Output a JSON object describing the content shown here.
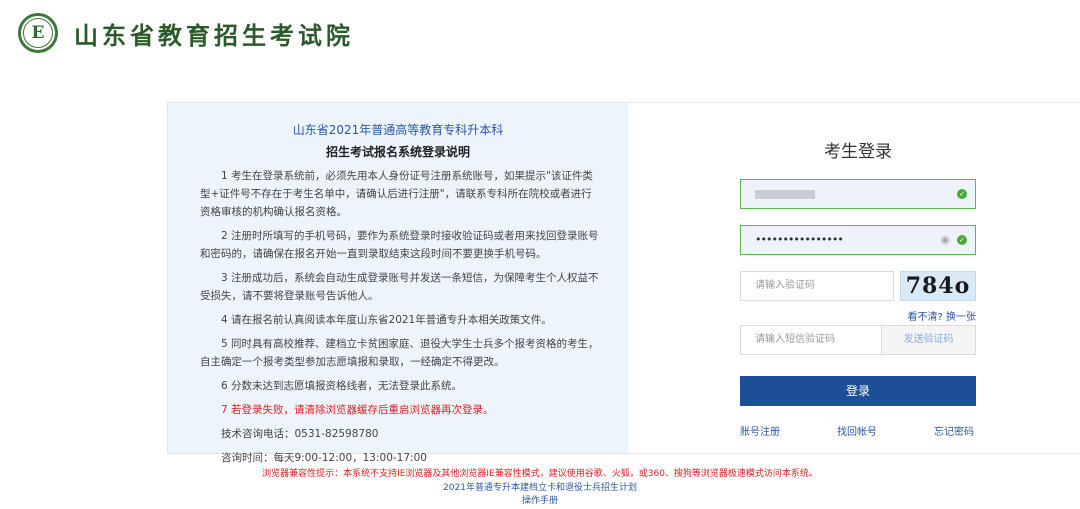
{
  "header": {
    "logo_letter": "E",
    "site_title": "山东省教育招生考试院"
  },
  "notice": {
    "title_line1": "山东省2021年普通高等教育专科升本科",
    "title_line2": "招生考试报名系统登录说明",
    "paragraphs": [
      "1 考生在登录系统前，必须先用本人身份证号注册系统账号，如果提示\"该证件类型+证件号不存在于考生名单中，请确认后进行注册\"，请联系专科所在院校或者进行资格审核的机构确认报名资格。",
      "2 注册时所填写的手机号码，要作为系统登录时接收验证码或者用来找回登录账号和密码的，请确保在报名开始一直到录取结束这段时间不要更换手机号码。",
      "3 注册成功后，系统会自动生成登录账号并发送一条短信，为保障考生个人权益不受损失，请不要将登录账号告诉他人。",
      "4 请在报名前认真阅读本年度山东省2021年普通专升本相关政策文件。",
      "5 同时具有高校推荐、建档立卡贫困家庭、退役大学生士兵多个报考资格的考生，自主确定一个报考类型参加志愿填报和录取，一经确定不得更改。",
      "6 分数未达到志愿填报资格线者，无法登录此系统。",
      "7 若登录失败，请清除浏览器缓存后重启浏览器再次登录。",
      "技术咨询电话：0531-82598780",
      "咨询时间：每天9:00-12:00，13:00-17:00"
    ]
  },
  "login": {
    "title": "考生登录",
    "password_value": "••••••••••••••••",
    "captcha_placeholder": "请输入验证码",
    "captcha_code": "784o",
    "refresh_label": "看不清? 换一张",
    "sms_placeholder": "请输入短信验证码",
    "sms_button": "发送验证码",
    "submit_label": "登录",
    "link_register": "账号注册",
    "link_find": "找回帐号",
    "link_forgot": "忘记密码"
  },
  "footer": {
    "compat_notice": "浏览器兼容性提示：本系统不支持IE浏览器及其他浏览器IE兼容性模式，建议使用谷歌、火狐，或360、搜狗等浏览器极速模式访问本系统。",
    "plan_link": "2021年普通专升本建档立卡和退役士兵招生计划",
    "manual_link": "操作手册"
  },
  "colors": {
    "accent": "#1d4f99",
    "link": "#2a57a8",
    "warning": "#e02020",
    "success": "#4aa83a",
    "notice_bg": "#edf4fc"
  }
}
